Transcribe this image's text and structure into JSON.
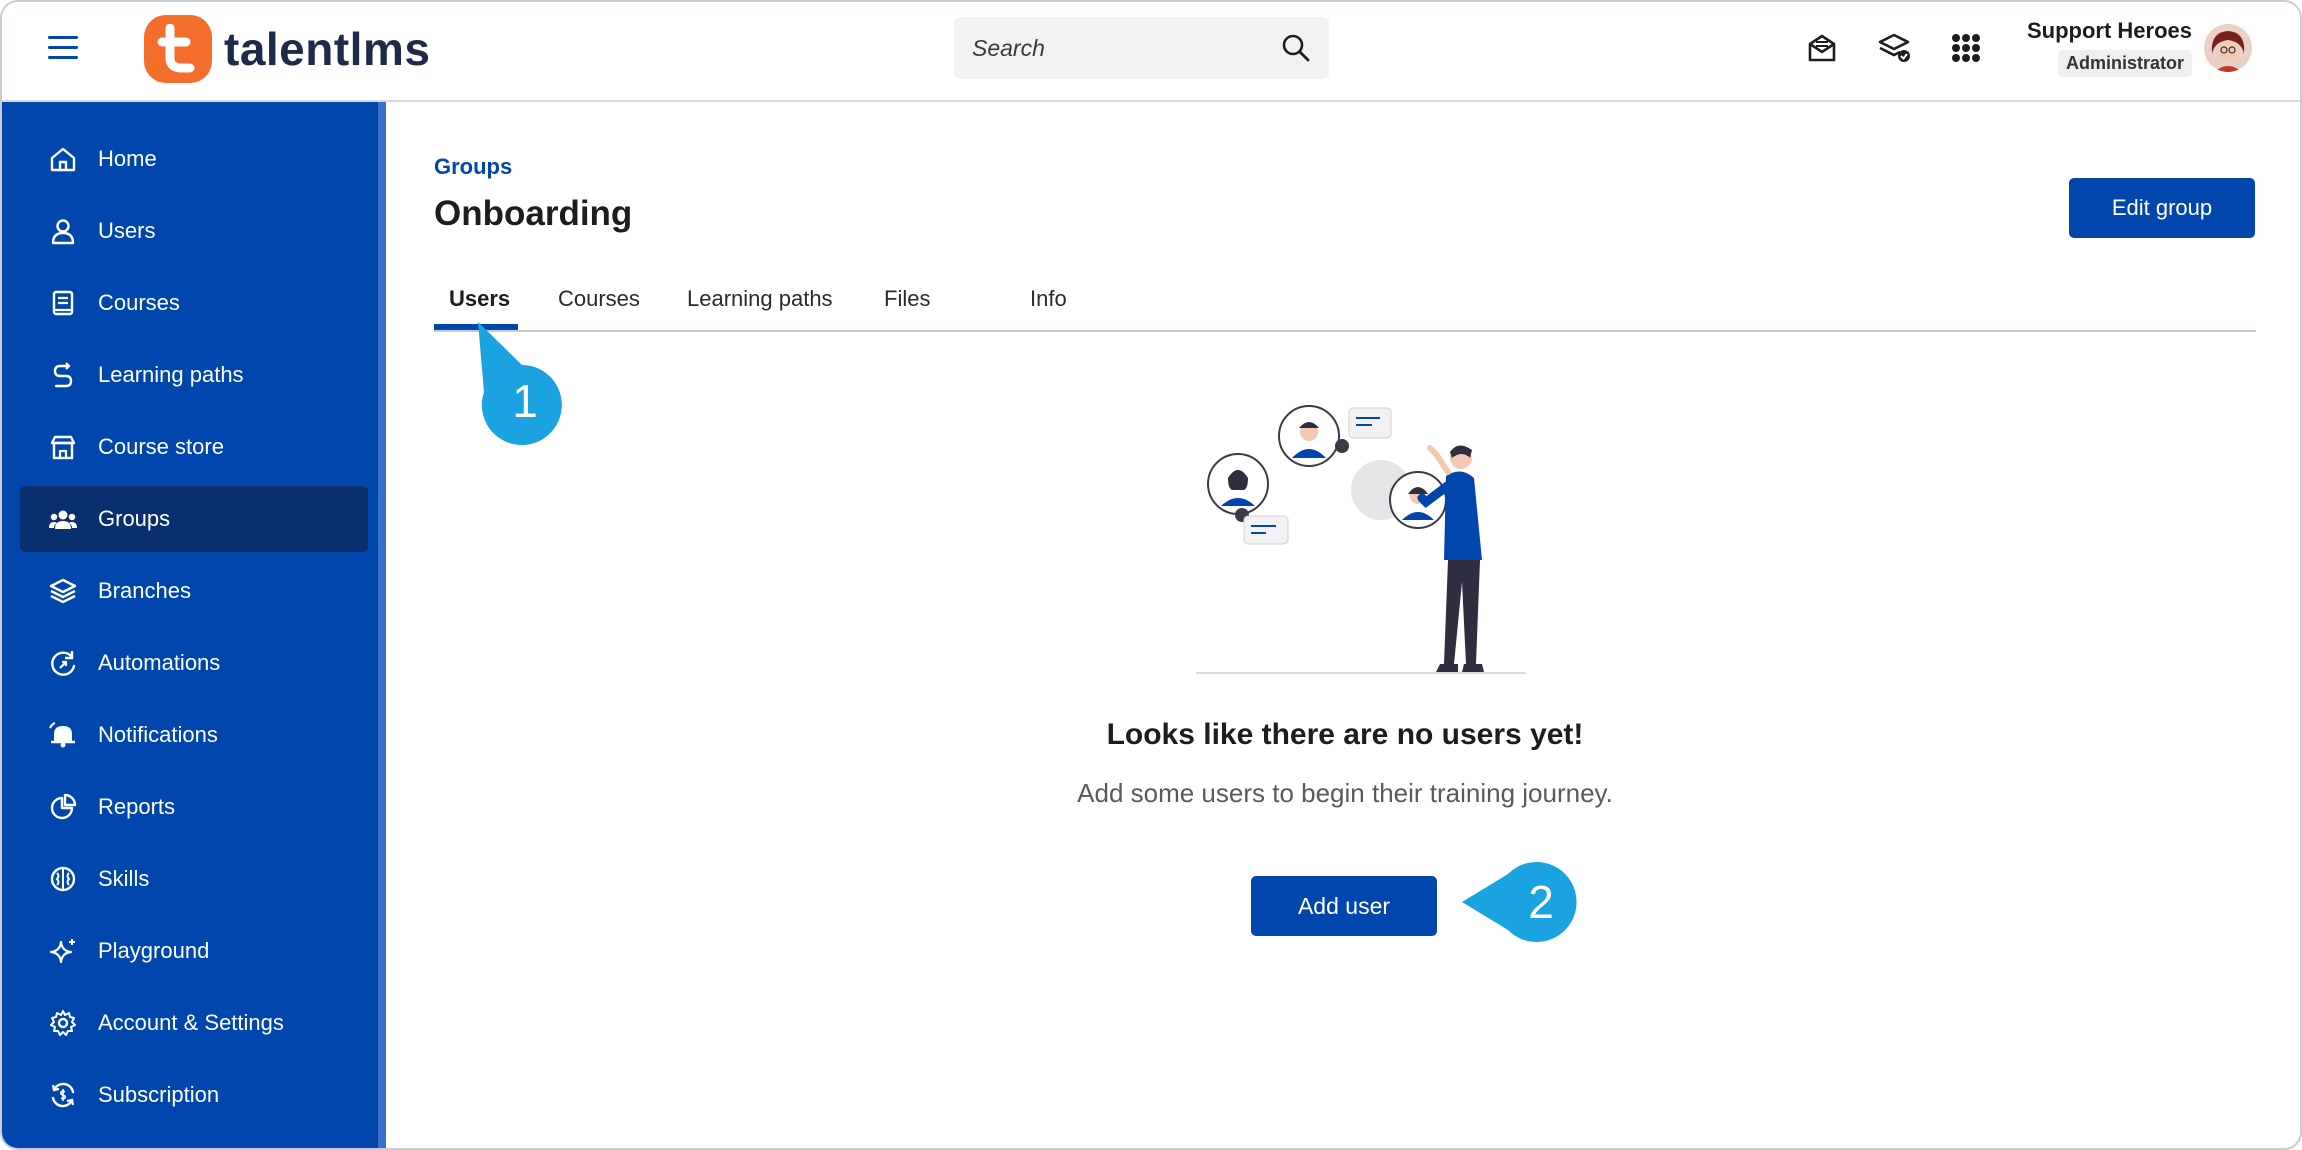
{
  "header": {
    "logo_text": "talentlms",
    "search_placeholder": "Search",
    "user_name": "Support Heroes",
    "user_role": "Administrator"
  },
  "sidebar": {
    "items": [
      {
        "label": "Home",
        "icon": "home-icon"
      },
      {
        "label": "Users",
        "icon": "user-icon"
      },
      {
        "label": "Courses",
        "icon": "book-icon"
      },
      {
        "label": "Learning paths",
        "icon": "path-icon"
      },
      {
        "label": "Course store",
        "icon": "store-icon"
      },
      {
        "label": "Groups",
        "icon": "groups-icon",
        "active": true
      },
      {
        "label": "Branches",
        "icon": "layers-icon"
      },
      {
        "label": "Automations",
        "icon": "automation-icon"
      },
      {
        "label": "Notifications",
        "icon": "bell-icon"
      },
      {
        "label": "Reports",
        "icon": "pie-chart-icon"
      },
      {
        "label": "Skills",
        "icon": "brain-icon"
      },
      {
        "label": "Playground",
        "icon": "sparkle-icon"
      },
      {
        "label": "Account & Settings",
        "icon": "gear-icon"
      },
      {
        "label": "Subscription",
        "icon": "refresh-dollar-icon"
      }
    ]
  },
  "main": {
    "breadcrumb": "Groups",
    "title": "Onboarding",
    "edit_button": "Edit group",
    "tabs": [
      {
        "label": "Users",
        "active": true
      },
      {
        "label": "Courses"
      },
      {
        "label": "Learning paths"
      },
      {
        "label": "Files"
      },
      {
        "label": "Info"
      }
    ],
    "empty_title": "Looks like there are no users yet!",
    "empty_subtitle": "Add some users to begin their training journey.",
    "add_button": "Add user"
  },
  "callouts": [
    "1",
    "2"
  ],
  "colors": {
    "brand_blue": "#0046ad",
    "active_nav": "#0a2f6e",
    "logo_orange": "#f36d2b",
    "callout": "#1aa3e0"
  }
}
